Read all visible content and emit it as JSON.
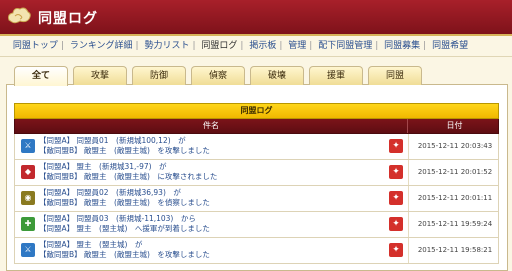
{
  "header": {
    "title": "同盟ログ"
  },
  "nav": [
    {
      "label": "同盟トップ",
      "current": false
    },
    {
      "label": "ランキング詳細",
      "current": false
    },
    {
      "label": "勢力リスト",
      "current": false
    },
    {
      "label": "同盟ログ",
      "current": true
    },
    {
      "label": "掲示板",
      "current": false
    },
    {
      "label": "管理",
      "current": false
    },
    {
      "label": "配下同盟管理",
      "current": false
    },
    {
      "label": "同盟募集",
      "current": false
    },
    {
      "label": "同盟希望",
      "current": false
    }
  ],
  "tabs": [
    "全て",
    "攻撃",
    "防御",
    "偵察",
    "破壊",
    "援軍",
    "同盟"
  ],
  "table": {
    "caption": "同盟ログ",
    "col_subject": "件名",
    "col_date": "日付",
    "rows": [
      {
        "icon": "sword-icon",
        "color": "blue",
        "line1": "【同盟A】 同盟員01　(新規城100,12)　が",
        "line2": "【敵同盟B】 敵盟主　(敵盟主城)　を攻撃しました",
        "date": "2015-12-11 20:03:43"
      },
      {
        "icon": "shield-icon",
        "color": "red",
        "line1": "【同盟A】 盟主　(新規城31,-97)　が",
        "line2": "【敵同盟B】 敵盟主　(敵盟主城)　に攻撃されました",
        "date": "2015-12-11 20:01:52"
      },
      {
        "icon": "scout-icon",
        "color": "olive",
        "line1": "【同盟A】 同盟員02　(新規城36,93)　が",
        "line2": "【敵同盟B】 敵盟主　(敵盟主城)　を偵察しました",
        "date": "2015-12-11 20:01:11"
      },
      {
        "icon": "reinforce-icon",
        "color": "green",
        "line1": "【同盟A】 同盟員03　(新規城-11,103)　から",
        "line2": "【同盟A】 盟主　(盟主城)　へ援軍が到着しました",
        "date": "2015-12-11 19:59:24"
      },
      {
        "icon": "sword-icon",
        "color": "blue",
        "line1": "【同盟A】 盟主　(盟主城)　が",
        "line2": "【敵同盟B】 敵盟主　(敵盟主城)　を攻撃しました",
        "date": "2015-12-11 19:58:21"
      }
    ]
  }
}
